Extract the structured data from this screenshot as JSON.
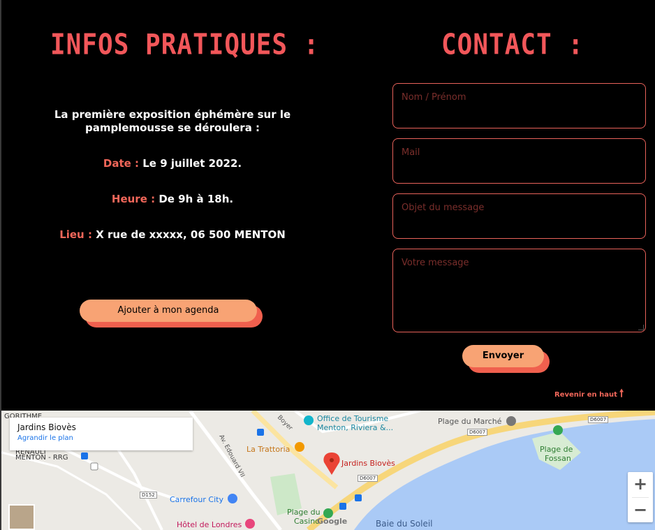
{
  "infos": {
    "title": "INFOS PRATIQUES :",
    "intro": "La première exposition éphémère sur le pamplemousse se déroulera :",
    "date_label": "Date :",
    "date_value": "Le 9 juillet 2022.",
    "hour_label": "Heure :",
    "hour_value": "De 9h à 18h.",
    "place_label": "Lieu :",
    "place_value": "X rue de xxxxx, 06 500 MENTON",
    "agenda_button": "Ajouter à mon agenda"
  },
  "contact": {
    "title": "CONTACT :",
    "name_placeholder": "Nom / Prénom",
    "mail_placeholder": "Mail",
    "subject_placeholder": "Objet du message",
    "message_placeholder": "Votre message",
    "send_button": "Envoyer",
    "back_to_top": "Revenir en haut",
    "back_to_top_icon": "arrow-up-icon"
  },
  "map": {
    "place_name": "Jardins Biovès",
    "enlarge_link": "Agrandir le plan",
    "labels": {
      "tourism": "Office de Tourisme",
      "tourism2": "Menton, Riviera &...",
      "trattoria": "La Trattoria",
      "pin": "Jardins Biovès",
      "marche": "Plage du Marché",
      "fossan": "Plage de",
      "fossan2": "Fossan",
      "carrefour": "Carrefour City",
      "londres": "Hôtel de Londres",
      "casino": "Plage du",
      "casino2": "Casino",
      "baie": "Baie du Soleil",
      "edouard": "Av. Edouard VII",
      "boyer": "Boyer",
      "gorithme": "GORITHME",
      "renault": "RENAULT",
      "menton_rrg": "MENTON - RRG",
      "google": "Google"
    },
    "roads": [
      "D6007",
      "D6007",
      "D6007",
      "D152"
    ],
    "zoom_in": "+",
    "zoom_out": "−"
  },
  "colors": {
    "accent": "#f2575a",
    "button": "#f8a374",
    "button_shadow": "#f0604e",
    "background": "#000000"
  }
}
